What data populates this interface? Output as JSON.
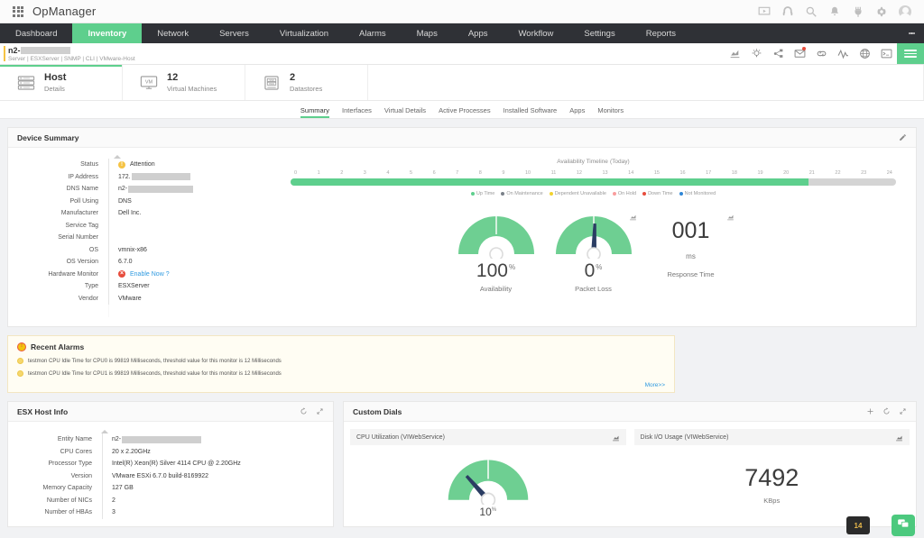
{
  "topbar": {
    "brand": "OpManager",
    "icons": [
      {
        "name": "presentation-icon"
      },
      {
        "name": "headset-icon"
      },
      {
        "name": "search-icon"
      },
      {
        "name": "bell-icon"
      },
      {
        "name": "plug-icon"
      },
      {
        "name": "gear-icon"
      },
      {
        "name": "user-avatar-icon"
      }
    ]
  },
  "nav": {
    "items": [
      {
        "label": "Dashboard",
        "active": false
      },
      {
        "label": "Inventory",
        "active": true
      },
      {
        "label": "Network",
        "active": false
      },
      {
        "label": "Servers",
        "active": false
      },
      {
        "label": "Virtualization",
        "active": false
      },
      {
        "label": "Alarms",
        "active": false
      },
      {
        "label": "Maps",
        "active": false
      },
      {
        "label": "Apps",
        "active": false
      },
      {
        "label": "Workflow",
        "active": false
      },
      {
        "label": "Settings",
        "active": false
      },
      {
        "label": "Reports",
        "active": false
      }
    ],
    "overflow_icon": "kebab-menu-icon"
  },
  "device_header": {
    "name_prefix": "n2-",
    "subtitle": "Server | ESXServer | SNMP | CLI | VMware-Host",
    "accent_color": "#f5c344",
    "tools": [
      {
        "name": "performance-chart-icon"
      },
      {
        "name": "alert-bulb-icon"
      },
      {
        "name": "network-share-icon"
      },
      {
        "name": "mail-icon",
        "badge": true
      },
      {
        "name": "link-icon"
      },
      {
        "name": "pulse-graph-icon"
      },
      {
        "name": "globe-icon"
      },
      {
        "name": "terminal-icon"
      },
      {
        "name": "hamburger-menu-icon"
      }
    ]
  },
  "entity_tabs": [
    {
      "icon": "server-rack-icon",
      "main": "Host",
      "sub": "Details",
      "active": true
    },
    {
      "icon": "vm-monitor-icon",
      "main": "12",
      "sub": "Virtual Machines",
      "active": false
    },
    {
      "icon": "datastore-disk-icon",
      "main": "2",
      "sub": "Datastores",
      "active": false
    }
  ],
  "sub_tabs": [
    {
      "label": "Summary",
      "active": true
    },
    {
      "label": "Interfaces",
      "active": false
    },
    {
      "label": "Virtual Details",
      "active": false
    },
    {
      "label": "Active Processes",
      "active": false
    },
    {
      "label": "Installed Software",
      "active": false
    },
    {
      "label": "Apps",
      "active": false
    },
    {
      "label": "Monitors",
      "active": false
    }
  ],
  "device_summary": {
    "title": "Device Summary",
    "edit_icon": "edit-pencil-icon",
    "rows": [
      {
        "key": "Status",
        "value": "Attention",
        "type": "status-warning"
      },
      {
        "key": "IP Address",
        "value": "172.",
        "type": "redacted",
        "redact_width": 65
      },
      {
        "key": "DNS Name",
        "value": "n2-",
        "type": "redacted",
        "redact_width": 72
      },
      {
        "key": "Poll Using",
        "value": "DNS",
        "type": "text"
      },
      {
        "key": "Manufacturer",
        "value": "Dell Inc.",
        "type": "text"
      },
      {
        "key": "Service Tag",
        "value": "",
        "type": "text"
      },
      {
        "key": "Serial Number",
        "value": "",
        "type": "text"
      },
      {
        "key": "OS",
        "value": "vmnix-x86",
        "type": "text"
      },
      {
        "key": "OS Version",
        "value": "6.7.0",
        "type": "text"
      },
      {
        "key": "Hardware Monitor",
        "value": "Enable Now ?",
        "type": "status-error-link"
      },
      {
        "key": "Type",
        "value": "ESXServer",
        "type": "text"
      },
      {
        "key": "Vendor",
        "value": "VMware",
        "type": "text"
      }
    ]
  },
  "availability": {
    "title": "Availability Timeline",
    "period": "(Today)",
    "ticks": [
      "0",
      "1",
      "2",
      "3",
      "4",
      "5",
      "6",
      "7",
      "8",
      "9",
      "10",
      "11",
      "12",
      "13",
      "14",
      "15",
      "16",
      "17",
      "18",
      "19",
      "20",
      "21",
      "22",
      "23",
      "24"
    ],
    "uptime_percent": 85.5,
    "legend": [
      {
        "label": "Up Time",
        "color": "#5ecf8d"
      },
      {
        "label": "On Maintenance",
        "color": "#7b8189"
      },
      {
        "label": "Dependent Unavailable",
        "color": "#f2d22e"
      },
      {
        "label": "On Hold",
        "color": "#f99d9d"
      },
      {
        "label": "Down Time",
        "color": "#e74c3c"
      },
      {
        "label": "Not Monitored",
        "color": "#2f86d6"
      }
    ]
  },
  "gauges": [
    {
      "name": "availability-gauge",
      "value": "100",
      "unit": "%",
      "label": "Availability",
      "needle_deg": 88,
      "has_mini_icon": false
    },
    {
      "name": "packet-loss-gauge",
      "value": "0",
      "unit": "%",
      "label": "Packet Loss",
      "needle_deg": -88,
      "has_mini_icon": true
    },
    {
      "name": "response-time-value",
      "value": "001",
      "unit": "ms",
      "label": "Response Time",
      "has_mini_icon": true
    }
  ],
  "recent_alarms": {
    "title": "Recent Alarms",
    "items": [
      "testmon CPU Idle Time for CPU0 is 99819 Milliseconds, threshold value for this monitor is 12 Milliseconds",
      "testmon CPU Idle Time for CPU1 is 99819 Milliseconds, threshold value for this monitor is 12 Milliseconds"
    ],
    "more_label": "More>>"
  },
  "esx_host_info": {
    "title": "ESX Host Info",
    "actions": [
      {
        "name": "refresh-icon"
      },
      {
        "name": "expand-icon"
      }
    ],
    "rows": [
      {
        "key": "Entity Name",
        "value": "n2-",
        "type": "redacted",
        "redact_width": 88
      },
      {
        "key": "CPU Cores",
        "value": "20 x 2.20GHz",
        "type": "text"
      },
      {
        "key": "Processor Type",
        "value": "Intel(R) Xeon(R) Silver 4114 CPU @ 2.20GHz",
        "type": "text"
      },
      {
        "key": "Version",
        "value": "VMware ESXi 6.7.0 build-8169922",
        "type": "text"
      },
      {
        "key": "Memory Capacity",
        "value": "127 GB",
        "type": "text"
      },
      {
        "key": "Number of NICs",
        "value": "2",
        "type": "text"
      },
      {
        "key": "Number of HBAs",
        "value": "3",
        "type": "text"
      }
    ]
  },
  "custom_dials": {
    "title": "Custom Dials",
    "actions": [
      {
        "name": "add-icon"
      },
      {
        "name": "refresh-icon"
      },
      {
        "name": "expand-icon"
      }
    ],
    "cards": [
      {
        "title": "CPU Utilization (VIWebService)",
        "icon": "bar-chart-icon",
        "kind": "gauge",
        "value": "10",
        "unit": "%",
        "needle_deg": -132
      },
      {
        "title": "Disk I/O Usage (VIWebService)",
        "icon": "bar-chart-icon",
        "kind": "number",
        "value": "7492",
        "unit": "KBps"
      }
    ]
  },
  "floating": {
    "notification_count": "14",
    "chat_icon": "chat-support-icon"
  },
  "colors": {
    "accent_green": "#5ecf8d",
    "nav_dark": "#2f3136",
    "warning": "#f5c344",
    "error": "#e74c3c",
    "link": "#2f9ae0"
  }
}
